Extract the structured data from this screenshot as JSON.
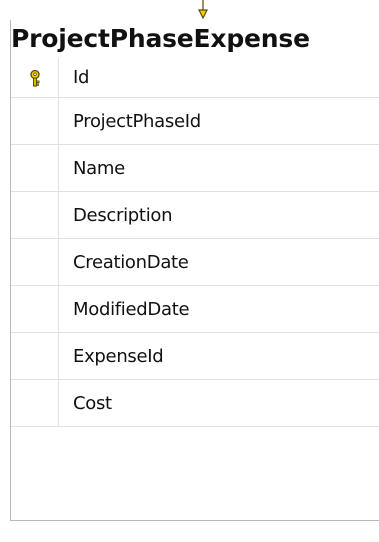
{
  "table": {
    "title": "ProjectPhaseExpense",
    "columns": [
      {
        "name": "Id",
        "primary_key": true,
        "icon": "key-icon"
      },
      {
        "name": "ProjectPhaseId",
        "primary_key": false
      },
      {
        "name": "Name",
        "primary_key": false
      },
      {
        "name": "Description",
        "primary_key": false
      },
      {
        "name": "CreationDate",
        "primary_key": false
      },
      {
        "name": "ModifiedDate",
        "primary_key": false
      },
      {
        "name": "ExpenseId",
        "primary_key": false
      },
      {
        "name": "Cost",
        "primary_key": false
      }
    ]
  },
  "colors": {
    "key_fill": "#f5d000",
    "key_stroke": "#5a4a00",
    "connector": "#f5d000",
    "border": "#b7b7b7",
    "gridline": "#e1e1e1"
  }
}
